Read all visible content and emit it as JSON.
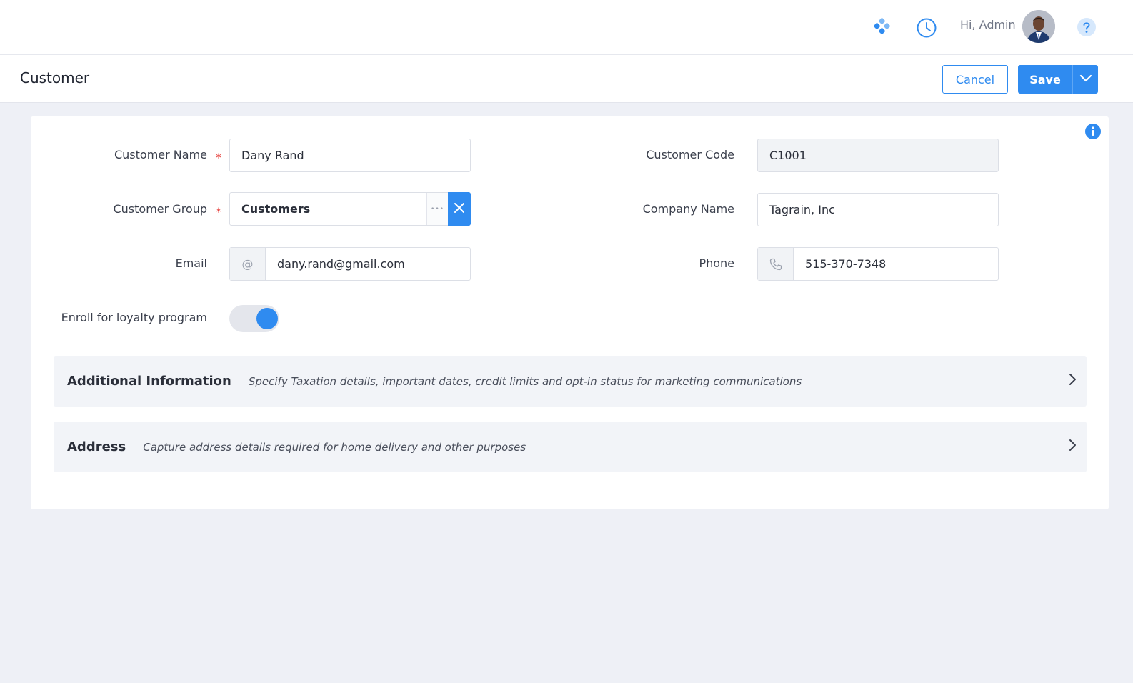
{
  "header": {
    "greeting": "Hi, Admin",
    "icons": [
      "apps-icon",
      "history-clock-icon",
      "user-avatar",
      "help-icon"
    ],
    "accent_color": "#2f8bf0"
  },
  "toolbar": {
    "page_title": "Customer",
    "cancel_label": "Cancel",
    "save_label": "Save"
  },
  "form": {
    "customer_name": {
      "label": "Customer Name",
      "value": "Dany Rand",
      "required": true
    },
    "customer_code": {
      "label": "Customer Code",
      "value": "C1001",
      "readonly": true
    },
    "customer_group": {
      "label": "Customer Group",
      "value": "Customers",
      "required": true,
      "dots": "•••"
    },
    "company_name": {
      "label": "Company Name",
      "value": "Tagrain, Inc"
    },
    "email": {
      "label": "Email",
      "value": "dany.rand@gmail.com",
      "addon": "@"
    },
    "phone": {
      "label": "Phone",
      "value": "515-370-7348"
    },
    "loyalty": {
      "label": "Enroll for loyalty program",
      "enabled": true
    },
    "required_mark": "*"
  },
  "sections": [
    {
      "title": "Additional Information",
      "description": "Specify Taxation details, important dates, credit limits and opt-in status for marketing communications"
    },
    {
      "title": "Address",
      "description": "Capture address details required for home delivery and other purposes"
    }
  ]
}
